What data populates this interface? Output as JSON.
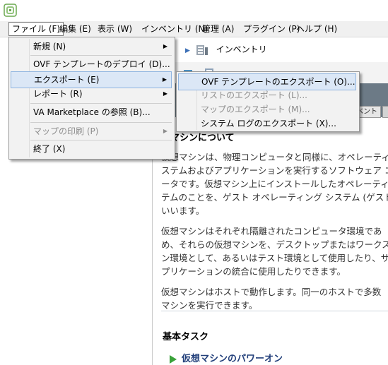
{
  "menubar": {
    "items": [
      {
        "label": "ファイル (F)",
        "active": true
      },
      {
        "label": "編集 (E)"
      },
      {
        "label": "表示 (W)"
      },
      {
        "label": "インベントリ (N)"
      },
      {
        "label": "管理 (A)"
      },
      {
        "label": "プラグイン (P)"
      },
      {
        "label": "ヘルプ (H)"
      }
    ]
  },
  "file_menu": {
    "items": [
      {
        "label": "新規 (N)",
        "submenu": true
      },
      {
        "label": "OVF テンプレートのデプロイ (D)..."
      },
      {
        "label": "エクスポート (E)",
        "submenu": true,
        "selected": true
      },
      {
        "label": "レポート (R)",
        "submenu": true
      },
      {
        "label": "VA Marketplace の参照 (B)..."
      },
      {
        "label": "マップの印刷 (P)",
        "submenu": true,
        "disabled": true
      },
      {
        "label": "終了 (X)"
      }
    ]
  },
  "export_submenu": {
    "items": [
      {
        "label": "OVF テンプレートのエクスポート (O)...",
        "selected": true
      },
      {
        "label": "リストのエクスポート (L)...",
        "disabled": true
      },
      {
        "label": "マップのエクスポート (M)...",
        "disabled": true
      },
      {
        "label": "システム ログのエクスポート (X)..."
      }
    ]
  },
  "breadcrumb": {
    "label": "インベントリ"
  },
  "tab": {
    "label": "ベント"
  },
  "content": {
    "heading": "想マシンについて",
    "p1": "仮想マシンは、物理コンピュータと同様に、オペレーティ\nステムおよびアプリケーションを実行するソフトウェア コ\nータです。仮想マシン上にインストールしたオペレーティ\nテムのことを、ゲスト オペレーティング システム (ゲスト\nいいます。",
    "p2": "仮想マシンはそれぞれ隔離されたコンピュータ環境であ\nめ、それらの仮想マシンを、デスクトップまたはワークス\nン環境として、あるいはテスト環境として使用したり、サ\nプリケーションの統合に使用したりできます。",
    "p3": "仮想マシンはホストで動作します。同一のホストで多数\nマシンを実行できます。",
    "basic_tasks": "基本タスク",
    "power_on": "仮想マシンのパワーオン"
  },
  "colors": {
    "accent": "#3aa23a",
    "selection": "#dbe7f6",
    "link": "#223f7a"
  }
}
